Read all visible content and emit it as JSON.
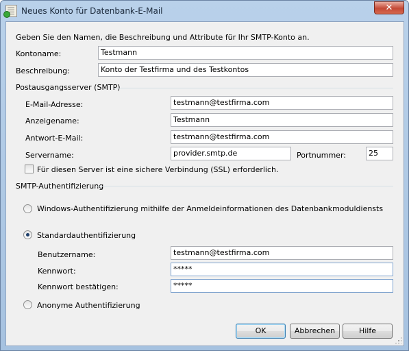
{
  "window": {
    "title": "Neues Konto für Datenbank-E-Mail",
    "close_glyph": "✕"
  },
  "intro": "Geben Sie den Namen, die Beschreibung und Attribute für Ihr SMTP-Konto an.",
  "account": {
    "name_label": "Kontoname:",
    "name_value": "Testmann",
    "description_label": "Beschreibung:",
    "description_value": "Konto der Testfirma und des Testkontos"
  },
  "smtp": {
    "group_label": "Postausgangsserver (SMTP)",
    "email_label": "E-Mail-Adresse:",
    "email_value": "testmann@testfirma.com",
    "display_label": "Anzeigename:",
    "display_value": "Testmann",
    "reply_label": "Antwort-E-Mail:",
    "reply_value": "testmann@testfirma.com",
    "server_label": "Servername:",
    "server_value": "provider.smtp.de",
    "port_label": "Portnummer:",
    "port_value": "25",
    "ssl_label": "Für diesen Server ist eine sichere Verbindung (SSL) erforderlich.",
    "ssl_checked": false
  },
  "auth": {
    "group_label": "SMTP-Authentifizierung",
    "windows_label": "Windows-Authentifizierung mithilfe der Anmeldeinformationen des Datenbankmoduldiensts",
    "standard_label": "Standardauthentifizierung",
    "selected": "standard",
    "user_label": "Benutzername:",
    "user_value": "testmann@testfirma.com",
    "password_label": "Kennwort:",
    "password_value": "*****",
    "confirm_label": "Kennwort bestätigen:",
    "confirm_value": "*****",
    "anonymous_label": "Anonyme Authentifizierung"
  },
  "buttons": {
    "ok": "OK",
    "cancel": "Abbrechen",
    "help": "Hilfe"
  }
}
